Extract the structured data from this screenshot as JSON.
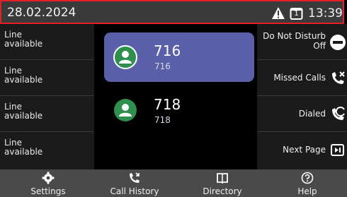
{
  "status_bar": {
    "date": "28.02.2024",
    "time": "13:39",
    "line_badge": "1"
  },
  "line_keys": [
    {
      "status": "Line\navailable"
    },
    {
      "status": "Line\navailable"
    },
    {
      "status": "Line\navailable"
    },
    {
      "status": "Line\navailable"
    }
  ],
  "calls": [
    {
      "number": "716",
      "sub": "716",
      "selected": true
    },
    {
      "number": "718",
      "sub": "718",
      "selected": false
    }
  ],
  "softkeys": {
    "dnd_line1": "Do Not Disturb",
    "dnd_line2": "Off",
    "missed": "Missed Calls",
    "dialed": "Dialed",
    "next_page": "Next Page"
  },
  "nav": {
    "settings": "Settings",
    "call_history": "Call History",
    "directory": "Directory",
    "help": "Help"
  },
  "colors": {
    "accent_border": "#e32027",
    "selected_card": "#5960a8",
    "avatar_green": "#2f8f4e"
  }
}
